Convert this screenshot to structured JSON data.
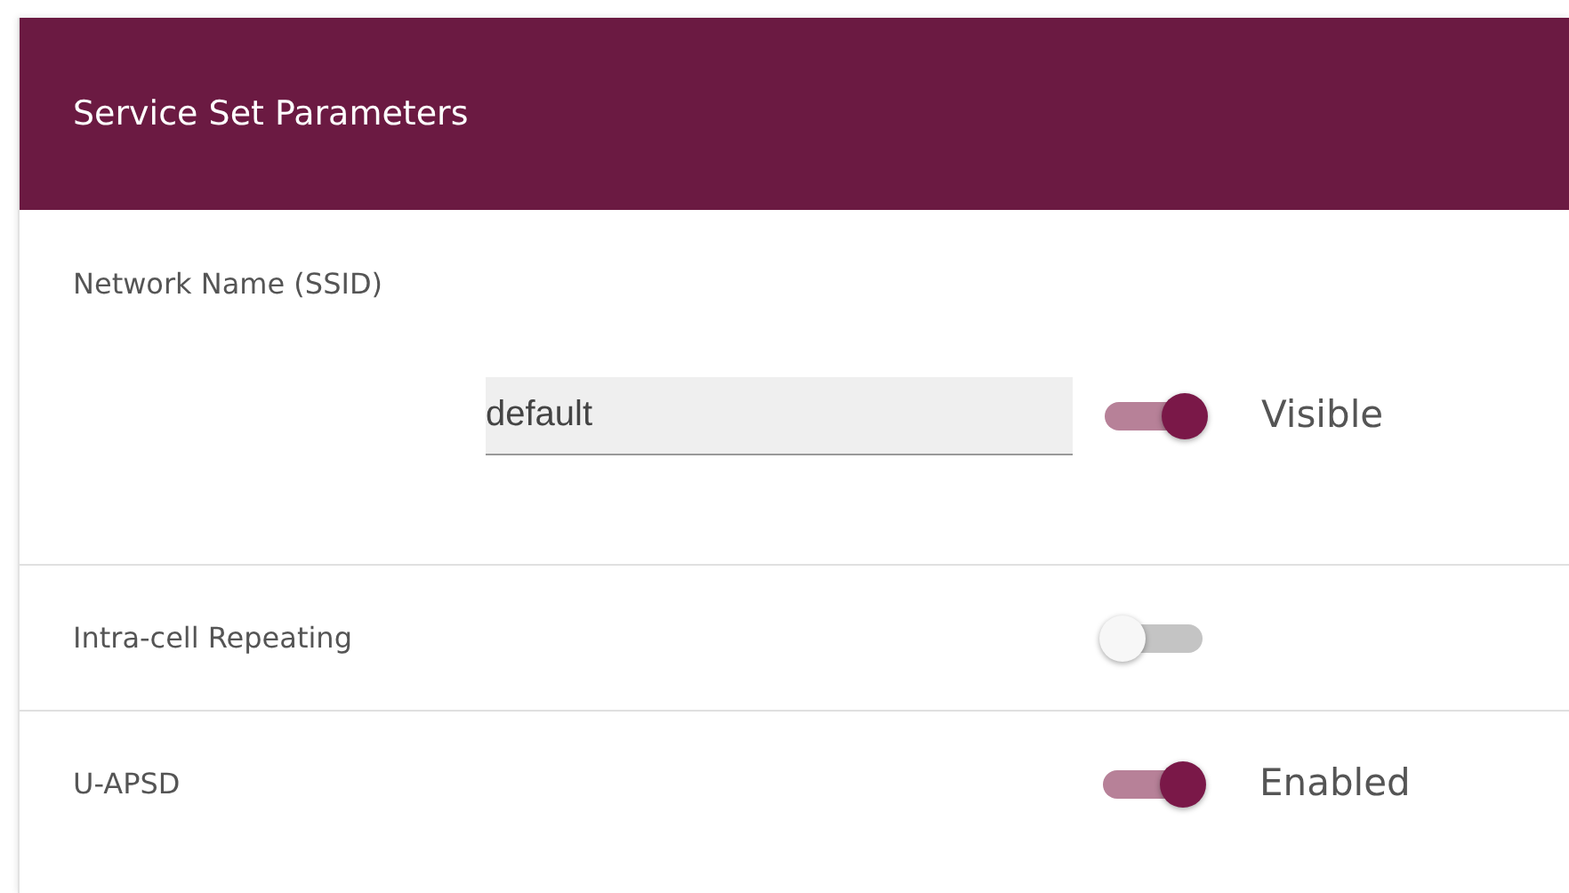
{
  "panel": {
    "title": "Service Set Parameters"
  },
  "settings": [
    {
      "kind": "ssid",
      "label": "Network Name (SSID)",
      "value": "default",
      "on": true,
      "state_label": "Visible"
    },
    {
      "kind": "toggle",
      "label": "Intra-cell Repeating",
      "on": false
    },
    {
      "kind": "toggle",
      "label": "U-APSD",
      "on": true,
      "state_label": "Enabled"
    }
  ]
}
